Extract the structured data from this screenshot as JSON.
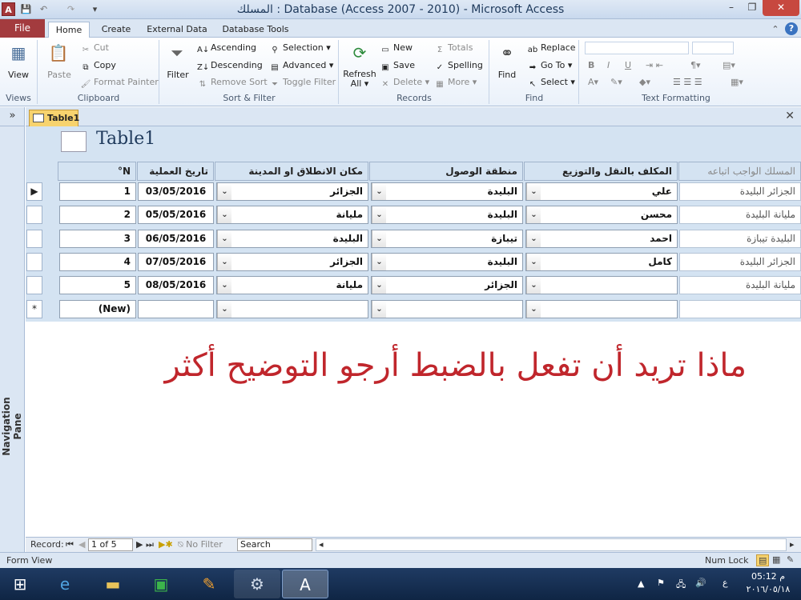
{
  "window": {
    "title": "المسلك : Database (Access 2007 - 2010)  -  Microsoft Access",
    "app_icon": "A",
    "min": "–",
    "restore": "❐",
    "close": "✕"
  },
  "quick_access": {
    "save": "💾",
    "undo": "↶",
    "redo": "↷",
    "customize": "▾"
  },
  "ribbon_tabs": {
    "file": "File",
    "home": "Home",
    "create": "Create",
    "external": "External Data",
    "dbtools": "Database Tools"
  },
  "ribbon": {
    "views": {
      "view": "View",
      "group": "Views"
    },
    "clipboard": {
      "paste": "Paste",
      "cut": "Cut",
      "copy": "Copy",
      "format_painter": "Format Painter",
      "group": "Clipboard"
    },
    "sort": {
      "filter": "Filter",
      "ascending": "Ascending",
      "descending": "Descending",
      "remove_sort": "Remove Sort",
      "selection": "Selection ▾",
      "advanced": "Advanced ▾",
      "toggle_filter": "Toggle Filter",
      "group": "Sort & Filter"
    },
    "records": {
      "refresh": "Refresh",
      "refresh2": "All ▾",
      "new": "New",
      "save": "Save",
      "delete": "Delete ▾",
      "totals": "Totals",
      "spelling": "Spelling",
      "more": "More ▾",
      "group": "Records"
    },
    "find": {
      "find": "Find",
      "replace": "Replace",
      "goto": "Go To ▾",
      "select": "Select ▾",
      "group": "Find"
    },
    "textfmt": {
      "group": "Text Formatting",
      "bold": "B",
      "italic": "I",
      "underline": "U"
    }
  },
  "nav": {
    "toggle": "»",
    "label": "Navigation Pane"
  },
  "document": {
    "tab": "Table1",
    "close": "✕",
    "form_title": "Table1"
  },
  "headers": {
    "n": "N°",
    "date": "تاريخ العملية",
    "origin": "مكان الانطلاق او المدينة",
    "dest": "منطقة الوصول",
    "driver": "المكلف بالنقل والتوزيع",
    "route": "المسلك الواجب اتباعه"
  },
  "rows": [
    {
      "selector": "▶",
      "n": "1",
      "date": "03/05/2016",
      "origin": "الجزائر",
      "dest": "البليدة",
      "driver": "علي",
      "route": "الجزائر البليدة"
    },
    {
      "selector": "",
      "n": "2",
      "date": "05/05/2016",
      "origin": "مليانة",
      "dest": "البليدة",
      "driver": "محسن",
      "route": "مليانة البليدة"
    },
    {
      "selector": "",
      "n": "3",
      "date": "06/05/2016",
      "origin": "البليدة",
      "dest": "تيبازة",
      "driver": "احمد",
      "route": "البليدة تيبازة"
    },
    {
      "selector": "",
      "n": "4",
      "date": "07/05/2016",
      "origin": "الجزائر",
      "dest": "البليدة",
      "driver": "كامل",
      "route": "الجزائر البليدة"
    },
    {
      "selector": "",
      "n": "5",
      "date": "08/05/2016",
      "origin": "مليانة",
      "dest": "الجزائر",
      "driver": "",
      "route": "مليانة البليدة"
    }
  ],
  "new_row": {
    "selector": "*",
    "n": "(New)"
  },
  "message": "ماذا تريد أن تفعل بالضبط أرجو التوضيح أكثر",
  "record_nav": {
    "label": "Record:",
    "first": "⏮",
    "prev": "◀",
    "position": "1 of 5",
    "next": "▶",
    "last": "⏭",
    "new": "▶✱",
    "no_filter": "No Filter",
    "search": "Search"
  },
  "status": {
    "view": "Form View",
    "numlock": "Num Lock"
  },
  "taskbar": {
    "time": "05:12 م",
    "date": "٢٠١٦/٠٥/١٨",
    "lang": "ع"
  }
}
